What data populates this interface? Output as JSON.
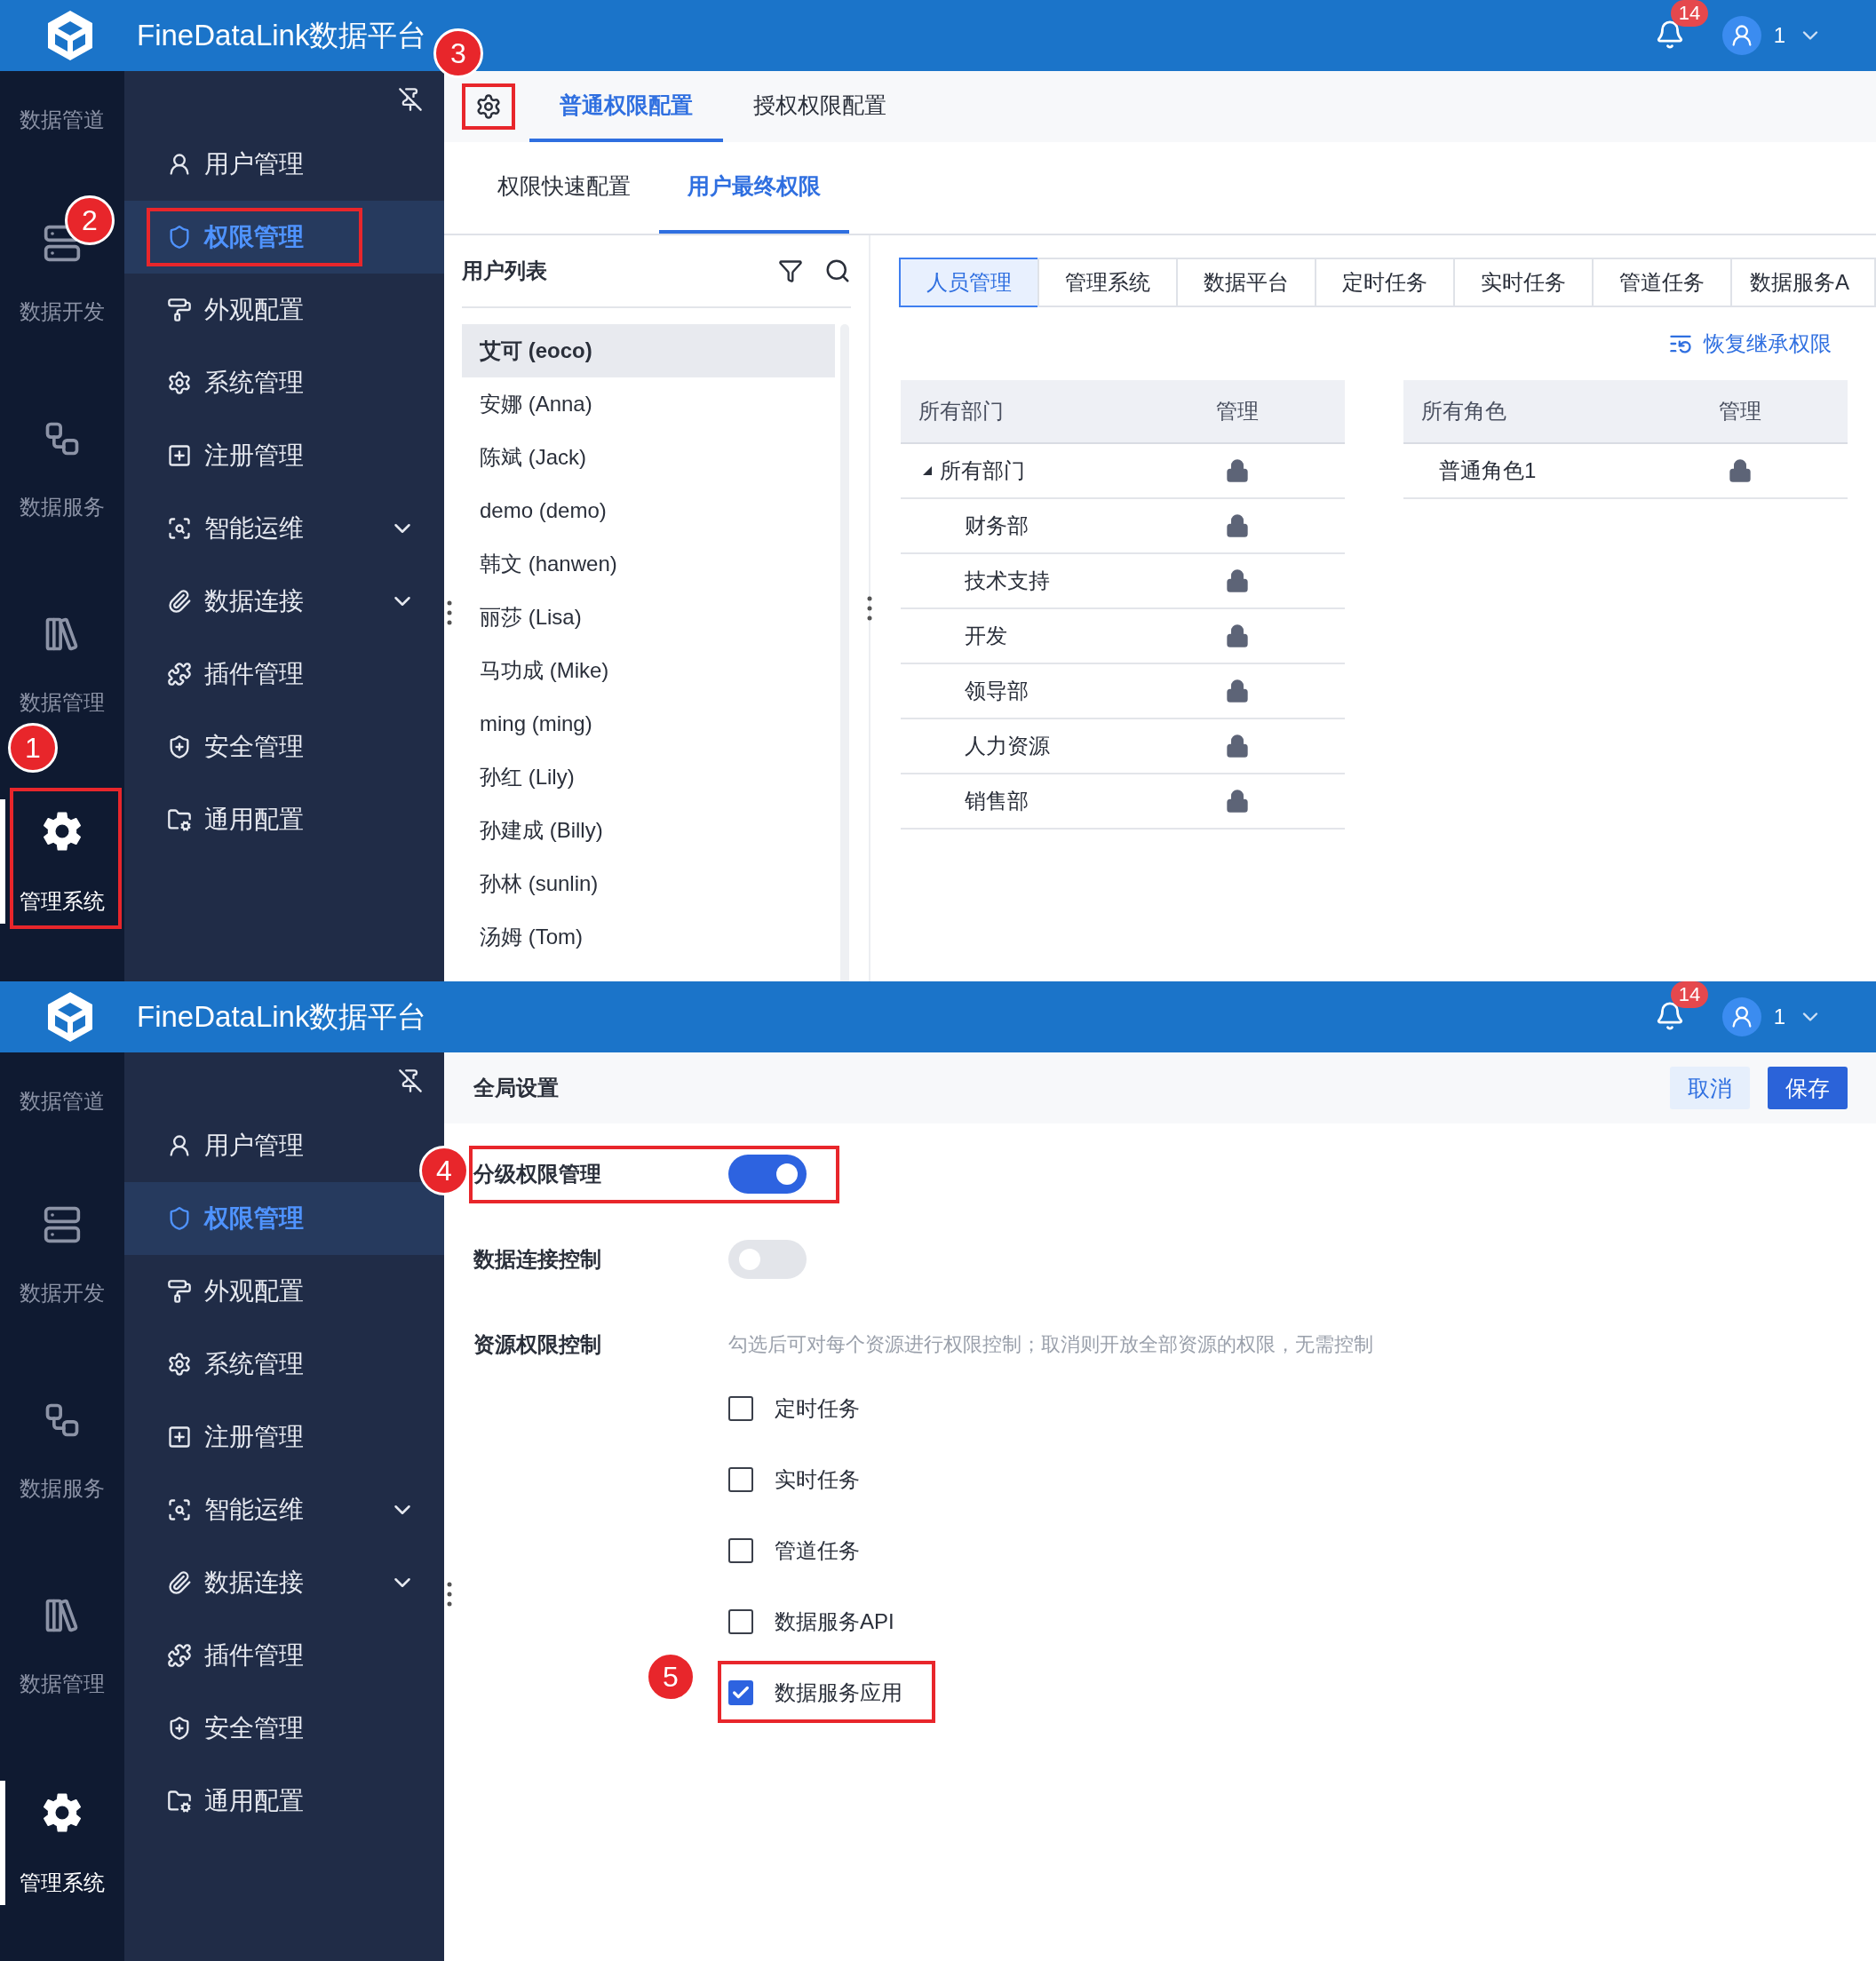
{
  "screens": [
    {
      "kind": "permissions",
      "header": {
        "title": "FineDataLink数据平台",
        "notifications": "14",
        "user": "1"
      },
      "rail": [
        {
          "label": "数据管道",
          "selected": false
        },
        {
          "label": "数据开发",
          "selected": false
        },
        {
          "label": "数据服务",
          "selected": false
        },
        {
          "label": "数据管理",
          "selected": false
        },
        {
          "label": "管理系统",
          "selected": true,
          "annotation": "1"
        }
      ],
      "nav": [
        {
          "label": "用户管理",
          "kind": "link",
          "selected": false
        },
        {
          "label": "权限管理",
          "kind": "link",
          "selected": true,
          "annotation": "2"
        },
        {
          "label": "外观配置",
          "kind": "link",
          "selected": false
        },
        {
          "label": "系统管理",
          "kind": "link",
          "selected": false
        },
        {
          "label": "注册管理",
          "kind": "link",
          "selected": false
        },
        {
          "label": "智能运维",
          "kind": "group",
          "selected": false
        },
        {
          "label": "数据连接",
          "kind": "group",
          "selected": false
        },
        {
          "label": "插件管理",
          "kind": "link",
          "selected": false
        },
        {
          "label": "安全管理",
          "kind": "link",
          "selected": false
        },
        {
          "label": "通用配置",
          "kind": "link",
          "selected": false
        }
      ],
      "settings_annotation": "3",
      "tabs": [
        {
          "label": "普通权限配置",
          "selected": true
        },
        {
          "label": "授权权限配置",
          "selected": false
        }
      ],
      "subtabs": [
        {
          "label": "权限快速配置",
          "selected": false
        },
        {
          "label": "用户最终权限",
          "selected": true
        }
      ],
      "user_list": {
        "title": "用户列表",
        "users": [
          {
            "name": "艾可 (eoco)",
            "selected": true
          },
          {
            "name": "安娜 (Anna)",
            "selected": false
          },
          {
            "name": "陈斌 (Jack)",
            "selected": false
          },
          {
            "name": "demo (demo)",
            "selected": false
          },
          {
            "name": "韩文 (hanwen)",
            "selected": false
          },
          {
            "name": "丽莎 (Lisa)",
            "selected": false
          },
          {
            "name": "马功成 (Mike)",
            "selected": false
          },
          {
            "name": "ming (ming)",
            "selected": false
          },
          {
            "name": "孙红 (Lily)",
            "selected": false
          },
          {
            "name": "孙建成 (Billy)",
            "selected": false
          },
          {
            "name": "孙林 (sunlin)",
            "selected": false
          },
          {
            "name": "汤姆 (Tom)",
            "selected": false
          }
        ]
      },
      "resource_tabs": [
        {
          "label": "人员管理",
          "selected": true
        },
        {
          "label": "管理系统",
          "selected": false
        },
        {
          "label": "数据平台",
          "selected": false
        },
        {
          "label": "定时任务",
          "selected": false
        },
        {
          "label": "实时任务",
          "selected": false
        },
        {
          "label": "管道任务",
          "selected": false
        },
        {
          "label": "数据服务A",
          "selected": false
        }
      ],
      "restore_link": "恢复继承权限",
      "departments": {
        "columns": [
          "所有部门",
          "管理"
        ],
        "rows": [
          {
            "name": "所有部门",
            "expanded": true,
            "children": [
              {
                "name": "财务部"
              },
              {
                "name": "技术支持"
              },
              {
                "name": "开发"
              },
              {
                "name": "领导部"
              },
              {
                "name": "人力资源"
              },
              {
                "name": "销售部"
              }
            ]
          }
        ]
      },
      "roles": {
        "columns": [
          "所有角色",
          "管理"
        ],
        "rows": [
          {
            "name": "普通角色1"
          }
        ]
      }
    },
    {
      "kind": "global_settings",
      "header": {
        "title": "FineDataLink数据平台",
        "notifications": "14",
        "user": "1"
      },
      "rail": [
        {
          "label": "数据管道",
          "selected": false
        },
        {
          "label": "数据开发",
          "selected": false
        },
        {
          "label": "数据服务",
          "selected": false
        },
        {
          "label": "数据管理",
          "selected": false
        },
        {
          "label": "管理系统",
          "selected": true
        }
      ],
      "nav": [
        {
          "label": "用户管理",
          "kind": "link",
          "selected": false
        },
        {
          "label": "权限管理",
          "kind": "link",
          "selected": true
        },
        {
          "label": "外观配置",
          "kind": "link",
          "selected": false
        },
        {
          "label": "系统管理",
          "kind": "link",
          "selected": false
        },
        {
          "label": "注册管理",
          "kind": "link",
          "selected": false
        },
        {
          "label": "智能运维",
          "kind": "group",
          "selected": false
        },
        {
          "label": "数据连接",
          "kind": "group",
          "selected": false
        },
        {
          "label": "插件管理",
          "kind": "link",
          "selected": false
        },
        {
          "label": "安全管理",
          "kind": "link",
          "selected": false
        },
        {
          "label": "通用配置",
          "kind": "link",
          "selected": false
        }
      ],
      "toolbar": {
        "title": "全局设置",
        "buttons": [
          {
            "label": "取消",
            "kind": "secondary"
          },
          {
            "label": "保存",
            "kind": "primary"
          }
        ]
      },
      "settings": [
        {
          "label": "分级权限管理",
          "kind": "toggle",
          "on": true,
          "annotation": "4"
        },
        {
          "label": "数据连接控制",
          "kind": "toggle",
          "on": false
        },
        {
          "label": "资源权限控制",
          "kind": "checklist",
          "hint": "勾选后可对每个资源进行权限控制；取消则开放全部资源的权限，无需控制",
          "options": [
            {
              "label": "定时任务",
              "checked": false
            },
            {
              "label": "实时任务",
              "checked": false
            },
            {
              "label": "管道任务",
              "checked": false
            },
            {
              "label": "数据服务API",
              "checked": false
            },
            {
              "label": "数据服务应用",
              "checked": true,
              "annotation": "5"
            }
          ]
        }
      ]
    }
  ]
}
